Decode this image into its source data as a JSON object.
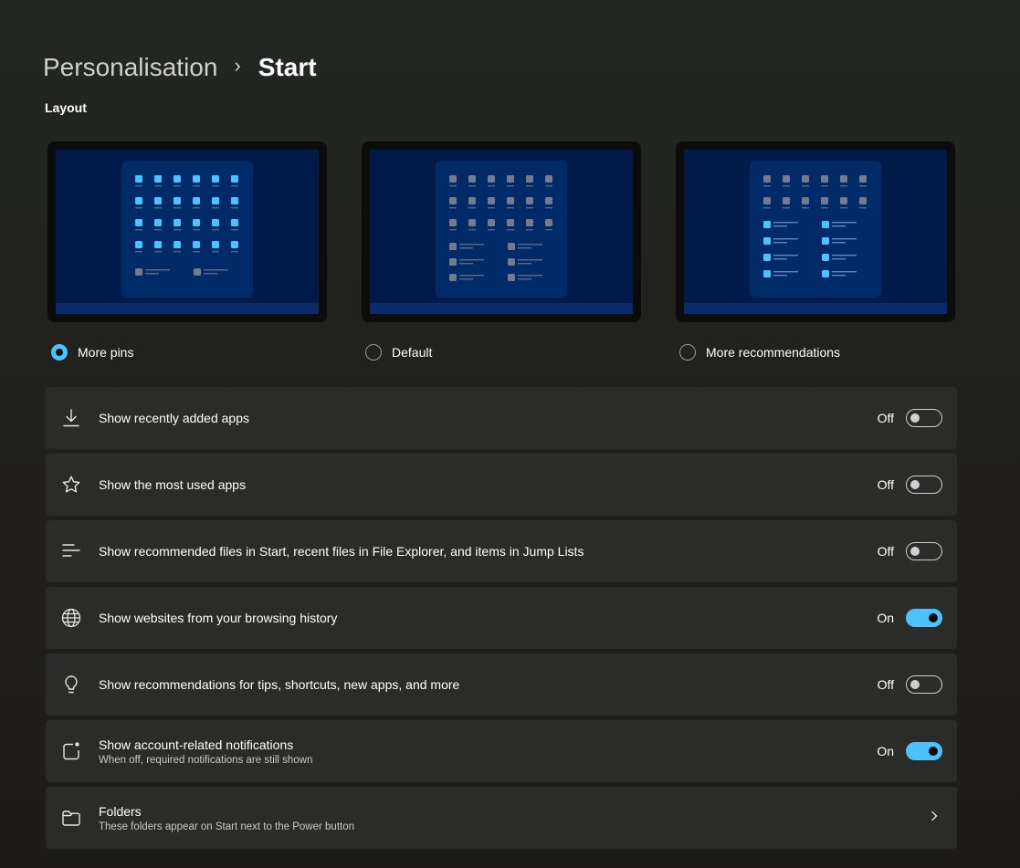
{
  "breadcrumb": {
    "parent": "Personalisation",
    "separator": "›",
    "current": "Start"
  },
  "layout_section": {
    "title": "Layout",
    "options": [
      {
        "label": "More pins",
        "selected": true,
        "pin_rows": 4,
        "rec_rows": 1
      },
      {
        "label": "Default",
        "selected": false,
        "pin_rows": 3,
        "rec_rows": 3
      },
      {
        "label": "More recommendations",
        "selected": false,
        "pin_rows": 2,
        "rec_rows": 4
      }
    ]
  },
  "colors": {
    "accent": "#4cc2ff",
    "card_background": "#2b2b29",
    "preview_desktop": "#001b4a",
    "preview_start_panel": "#002b68",
    "preview_taskbar": "#0a2a6b"
  },
  "settings": [
    {
      "icon": "download-icon",
      "title": "Show recently added apps",
      "description": "",
      "control": "toggle",
      "state": "Off",
      "on": false
    },
    {
      "icon": "star-icon",
      "title": "Show the most used apps",
      "description": "",
      "control": "toggle",
      "state": "Off",
      "on": false
    },
    {
      "icon": "list-lines-icon",
      "title": "Show recommended files in Start, recent files in File Explorer, and items in Jump Lists",
      "description": "",
      "control": "toggle",
      "state": "Off",
      "on": false
    },
    {
      "icon": "globe-icon",
      "title": "Show websites from your browsing history",
      "description": "",
      "control": "toggle",
      "state": "On",
      "on": true
    },
    {
      "icon": "lightbulb-icon",
      "title": "Show recommendations for tips, shortcuts, new apps, and more",
      "description": "",
      "control": "toggle",
      "state": "Off",
      "on": false
    },
    {
      "icon": "notification-badge-icon",
      "title": "Show account-related notifications",
      "description": "When off, required notifications are still shown",
      "control": "toggle",
      "state": "On",
      "on": true
    },
    {
      "icon": "folder-icon",
      "title": "Folders",
      "description": "These folders appear on Start next to the Power button",
      "control": "chevron"
    }
  ]
}
